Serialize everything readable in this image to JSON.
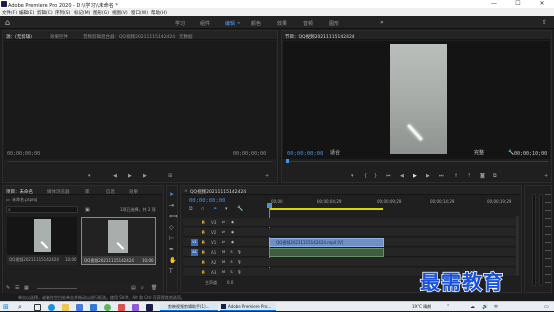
{
  "window": {
    "title": "Adobe Premiere Pro 2020 - D:\\\\学习\\\\未命名 *",
    "controls": [
      "—",
      "☐",
      "✕"
    ]
  },
  "menu": [
    "文件(F)",
    "编辑(E)",
    "剪辑(C)",
    "序列(S)",
    "标记(M)",
    "图形(G)",
    "视图(V)",
    "窗口(W)",
    "帮助(H)"
  ],
  "workspaces": [
    "学习",
    "组件",
    "编辑",
    "颜色",
    "效果",
    "音频",
    "图形"
  ],
  "workspace_active": "编辑",
  "source_panel": {
    "tabs": [
      "源：(无剪辑)",
      "效果控件",
      "音频剪辑混合器：QQ视频20211115142424",
      "元数据"
    ],
    "timecode_left": "00;00;00;00",
    "timecode_right": "00;00;00;00"
  },
  "program_panel": {
    "tab": "节目：QQ视频20211115142424",
    "timecode": "00;00;00;00",
    "fit": "适合",
    "quality": "完整",
    "duration": "00;00;10;00"
  },
  "project_panel": {
    "tabs": [
      "项目：未命名",
      "媒体浏览器",
      "库",
      "信息",
      "效果"
    ],
    "filename": "未命名.prproj",
    "count": "1项已选择，共 2 项",
    "items": [
      {
        "name": "QQ视频20211115142424",
        "duration": "10;00"
      },
      {
        "name": "QQ视频20211115142424",
        "duration": "10;00"
      }
    ]
  },
  "timeline": {
    "tab": "QQ视频20211115142424",
    "timecode": "00;00;00;00",
    "ruler": [
      "00;00",
      "00;00;04;29",
      "00;00;09;29",
      "00;00;14;29",
      "00;00;19;29"
    ],
    "tracks_video": [
      "V3",
      "V2",
      "V1"
    ],
    "tracks_audio": [
      "A1",
      "A2",
      "A3"
    ],
    "master": "主声道",
    "master_value": "0.0",
    "clip_video": "QQ视频20211115142424.mp4 [V]",
    "clip_audio": ""
  },
  "status": "单击以选择，或者在空白处单击并拖动以进行框选。使用 Shift、Alt 和 Ctrl 可获得其他选项。",
  "watermark": "最需教育",
  "taskbar": {
    "apps": [
      "剪映视频剪辑助手(1)...",
      "Adobe Premiere Pro..."
    ],
    "weather": "19°C 晴朗",
    "ime": "中",
    "colors": {
      "accent": "#0078d7"
    }
  },
  "colors": {
    "accent": "#4d8fe0",
    "workspace_active": "#5b9bf5",
    "clip": "#6f8fc5",
    "work_area": "#d8d400"
  }
}
